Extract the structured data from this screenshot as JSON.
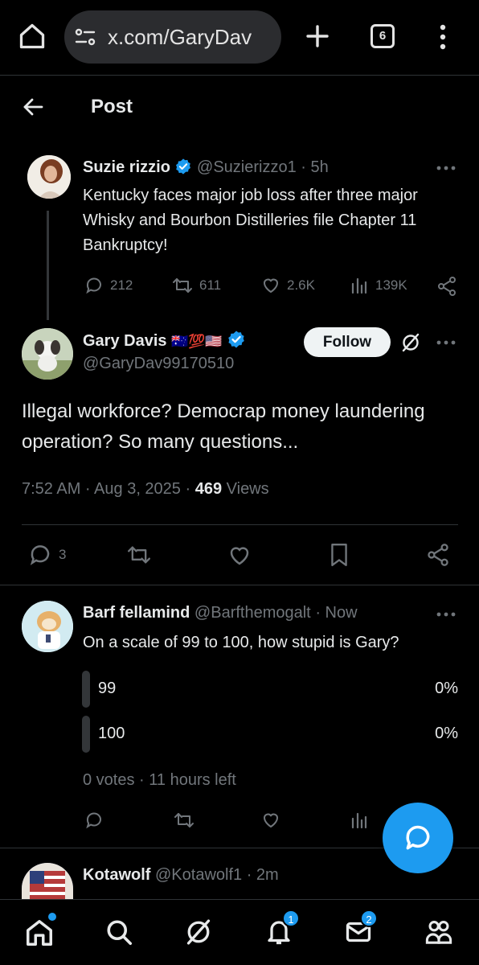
{
  "browser": {
    "url": "x.com/GaryDav",
    "tab_count": "6"
  },
  "header": {
    "title": "Post"
  },
  "parent_tweet": {
    "name": "Suzie rizzio",
    "handle": "@Suzierizzo1",
    "time": "· 5h",
    "text": "Kentucky faces major job loss after three major Whisky and Bourbon Distilleries file Chapter 11 Bankruptcy!",
    "replies": "212",
    "reposts": "611",
    "likes": "2.6K",
    "views": "139K"
  },
  "main_tweet": {
    "name": "Gary Davis",
    "flags": "🇦🇺💯🇺🇸",
    "handle": "@GaryDav99170510",
    "follow_label": "Follow",
    "text": "Illegal workforce? Democrap money laundering operation? So many questions...",
    "timestamp": "7:52 AM · Aug 3, 2025 ·",
    "views_count": "469",
    "views_label": "Views",
    "replies": "3"
  },
  "reply_tweet": {
    "name": "Barf fellamind",
    "handle": "@Barfthemogalt",
    "time": "· Now",
    "text": "On a scale of 99 to 100, how stupid is Gary?",
    "poll": {
      "options": [
        {
          "label": "99",
          "percent": "0%"
        },
        {
          "label": "100",
          "percent": "0%"
        }
      ],
      "status": "0 votes · 11 hours left"
    }
  },
  "next_tweet": {
    "name": "Kotawolf",
    "handle": "@Kotawolf1",
    "time": "· 2m"
  },
  "nav": {
    "notifications_badge": "1",
    "messages_badge": "2"
  },
  "colors": {
    "accent": "#1d9bf0",
    "muted": "#71767b",
    "text": "#e7e9ea",
    "divider": "#2f3336"
  }
}
